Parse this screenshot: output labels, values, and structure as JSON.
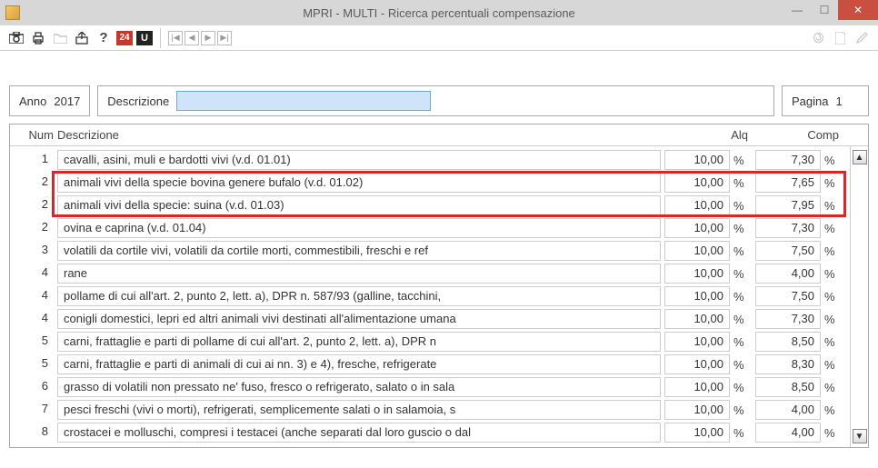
{
  "window": {
    "title": "MPRI  - MULTI -  Ricerca percentuali compensazione"
  },
  "toolbar": {
    "badge24": "24",
    "badgeU": "U"
  },
  "filters": {
    "anno_label": "Anno",
    "anno_value": "2017",
    "descrizione_label": "Descrizione",
    "descrizione_value": "",
    "pagina_label": "Pagina",
    "pagina_value": "1"
  },
  "columns": {
    "num": "Num",
    "descrizione": "Descrizione",
    "alq": "Alq",
    "comp": "Comp"
  },
  "percent_symbol": "%",
  "rows": [
    {
      "num": "1",
      "desc": "cavalli, asini, muli e bardotti vivi (v.d. 01.01)",
      "alq": "10,00",
      "comp": "7,30"
    },
    {
      "num": "2",
      "desc": "animali vivi della specie bovina genere bufalo (v.d. 01.02)",
      "alq": "10,00",
      "comp": "7,65"
    },
    {
      "num": "2",
      "desc": "animali vivi della specie: suina (v.d. 01.03)",
      "alq": "10,00",
      "comp": "7,95"
    },
    {
      "num": "2",
      "desc": "ovina e caprina (v.d. 01.04)",
      "alq": "10,00",
      "comp": "7,30"
    },
    {
      "num": "3",
      "desc": "volatili da cortile vivi, volatili da cortile morti, commestibili, freschi e ref",
      "alq": "10,00",
      "comp": "7,50"
    },
    {
      "num": "4",
      "desc": "rane",
      "alq": "10,00",
      "comp": "4,00"
    },
    {
      "num": "4",
      "desc": "pollame di cui all'art. 2, punto 2, lett. a), DPR n. 587/93 (galline, tacchini,",
      "alq": "10,00",
      "comp": "7,50"
    },
    {
      "num": "4",
      "desc": "conigli domestici, lepri ed altri animali vivi destinati all'alimentazione umana",
      "alq": "10,00",
      "comp": "7,30"
    },
    {
      "num": "5",
      "desc": "carni, frattaglie e parti di pollame di cui all'art. 2, punto 2, lett. a), DPR n",
      "alq": "10,00",
      "comp": "8,50"
    },
    {
      "num": "5",
      "desc": "carni, frattaglie e parti di animali di cui ai nn. 3) e 4), fresche, refrigerate",
      "alq": "10,00",
      "comp": "8,30"
    },
    {
      "num": "6",
      "desc": "grasso di volatili non pressato ne' fuso, fresco o refrigerato, salato o in sala",
      "alq": "10,00",
      "comp": "8,50"
    },
    {
      "num": "7",
      "desc": "pesci freschi (vivi o morti), refrigerati, semplicemente salati o in salamoia, s",
      "alq": "10,00",
      "comp": "4,00"
    },
    {
      "num": "8",
      "desc": "crostacei e molluschi, compresi i testacei (anche separati dal loro guscio o dal",
      "alq": "10,00",
      "comp": "4,00"
    }
  ]
}
